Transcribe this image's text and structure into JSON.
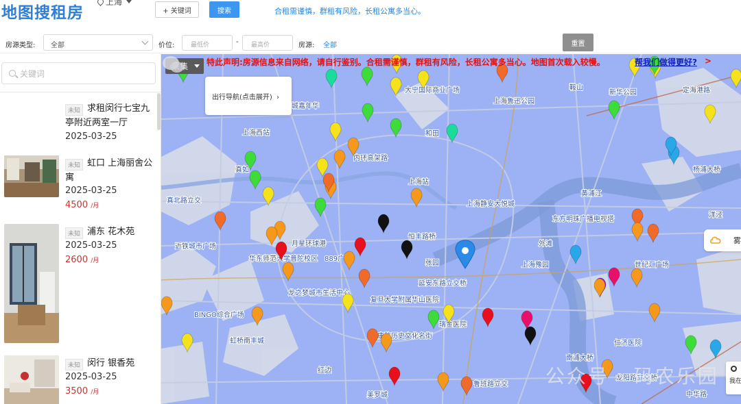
{
  "header": {
    "logo": "地图搜租房",
    "city": "上海",
    "keyword_button": "+ 关键词",
    "search_button": "搜索",
    "notice": "合租需谨慎，群租有风险，长租公寓多当心。"
  },
  "filters": {
    "type_label": "房源类型:",
    "type_value": "全部",
    "price_label": "价位:",
    "min_placeholder": "最低价",
    "dash": "-",
    "max_placeholder": "最高价",
    "source_label": "房源:",
    "source_value": "全部",
    "reset_button": "重置"
  },
  "sidebar": {
    "search_placeholder": "关键词",
    "listings": [
      {
        "tag": "未知",
        "title": "求租闵行七宝九亭附近两室一厅",
        "date": "2025-03-25",
        "price": "",
        "unit": ""
      },
      {
        "tag": "未知",
        "title": "虹口 上海丽舍公寓",
        "date": "2025-03-25",
        "price": "4500",
        "unit": "/月"
      },
      {
        "tag": "未知",
        "title": "浦东 花木苑",
        "date": "2025-03-25",
        "price": "2600",
        "unit": "/月"
      },
      {
        "tag": "未知",
        "title": "闵行 银香苑",
        "date": "2025-03-25",
        "price": "3500",
        "unit": "/月"
      }
    ]
  },
  "map": {
    "collect_button": "采集",
    "declaration": "特此声明:房源信息来自网络，请自行鉴别。合租需谨慎，群租有风险，长租公寓多当心。地图首次载入较慢。",
    "help_link": "帮我们做得更好?",
    "help_arrow": ">",
    "nav_panel": "出行导航(点击展开)",
    "nav_chevron": "›",
    "weather_text": "雾",
    "myloc_text": "我在",
    "watermark": "公众号 · 码农乐园",
    "labels": [
      "大宁国际商业广场",
      "上海鲁迅公园",
      "新华公园",
      "定海港路",
      "鞍山",
      "虎城嘉年华",
      "和田",
      "上海西站",
      "真如",
      "上海站",
      "内环高架路",
      "上海静安大悦城",
      "杨浦大桥",
      "黄浦江",
      "东方明珠广播电视塔",
      "真北路立交",
      "近铁城市广场",
      "月星环球港",
      "889广场",
      "华东师范大学普陀校区",
      "恒丰路桥",
      "外滩",
      "张园",
      "上海豫园",
      "世纪汇广场",
      "延安东路立交桥",
      "龙之梦城市生活中心",
      "复旦大学附属华山医院",
      "BINGO综合广场",
      "瑞金医院",
      "虹桥南丰城",
      "武康路历史文化名街",
      "仁济医院",
      "南浦大桥",
      "龙阳路立交桥",
      "红边",
      "美罗城",
      "鲁班路立交",
      "中华路",
      "洋泾"
    ],
    "pin_colors": [
      "#f5e21c",
      "#f5981c",
      "#3ddc3a",
      "#1cdc9a",
      "#e8101c",
      "#111111",
      "#e8106a",
      "#2aa7e8",
      "#9a10d8",
      "#f06a2a"
    ],
    "center_marker_color": "#2b8ae8"
  }
}
